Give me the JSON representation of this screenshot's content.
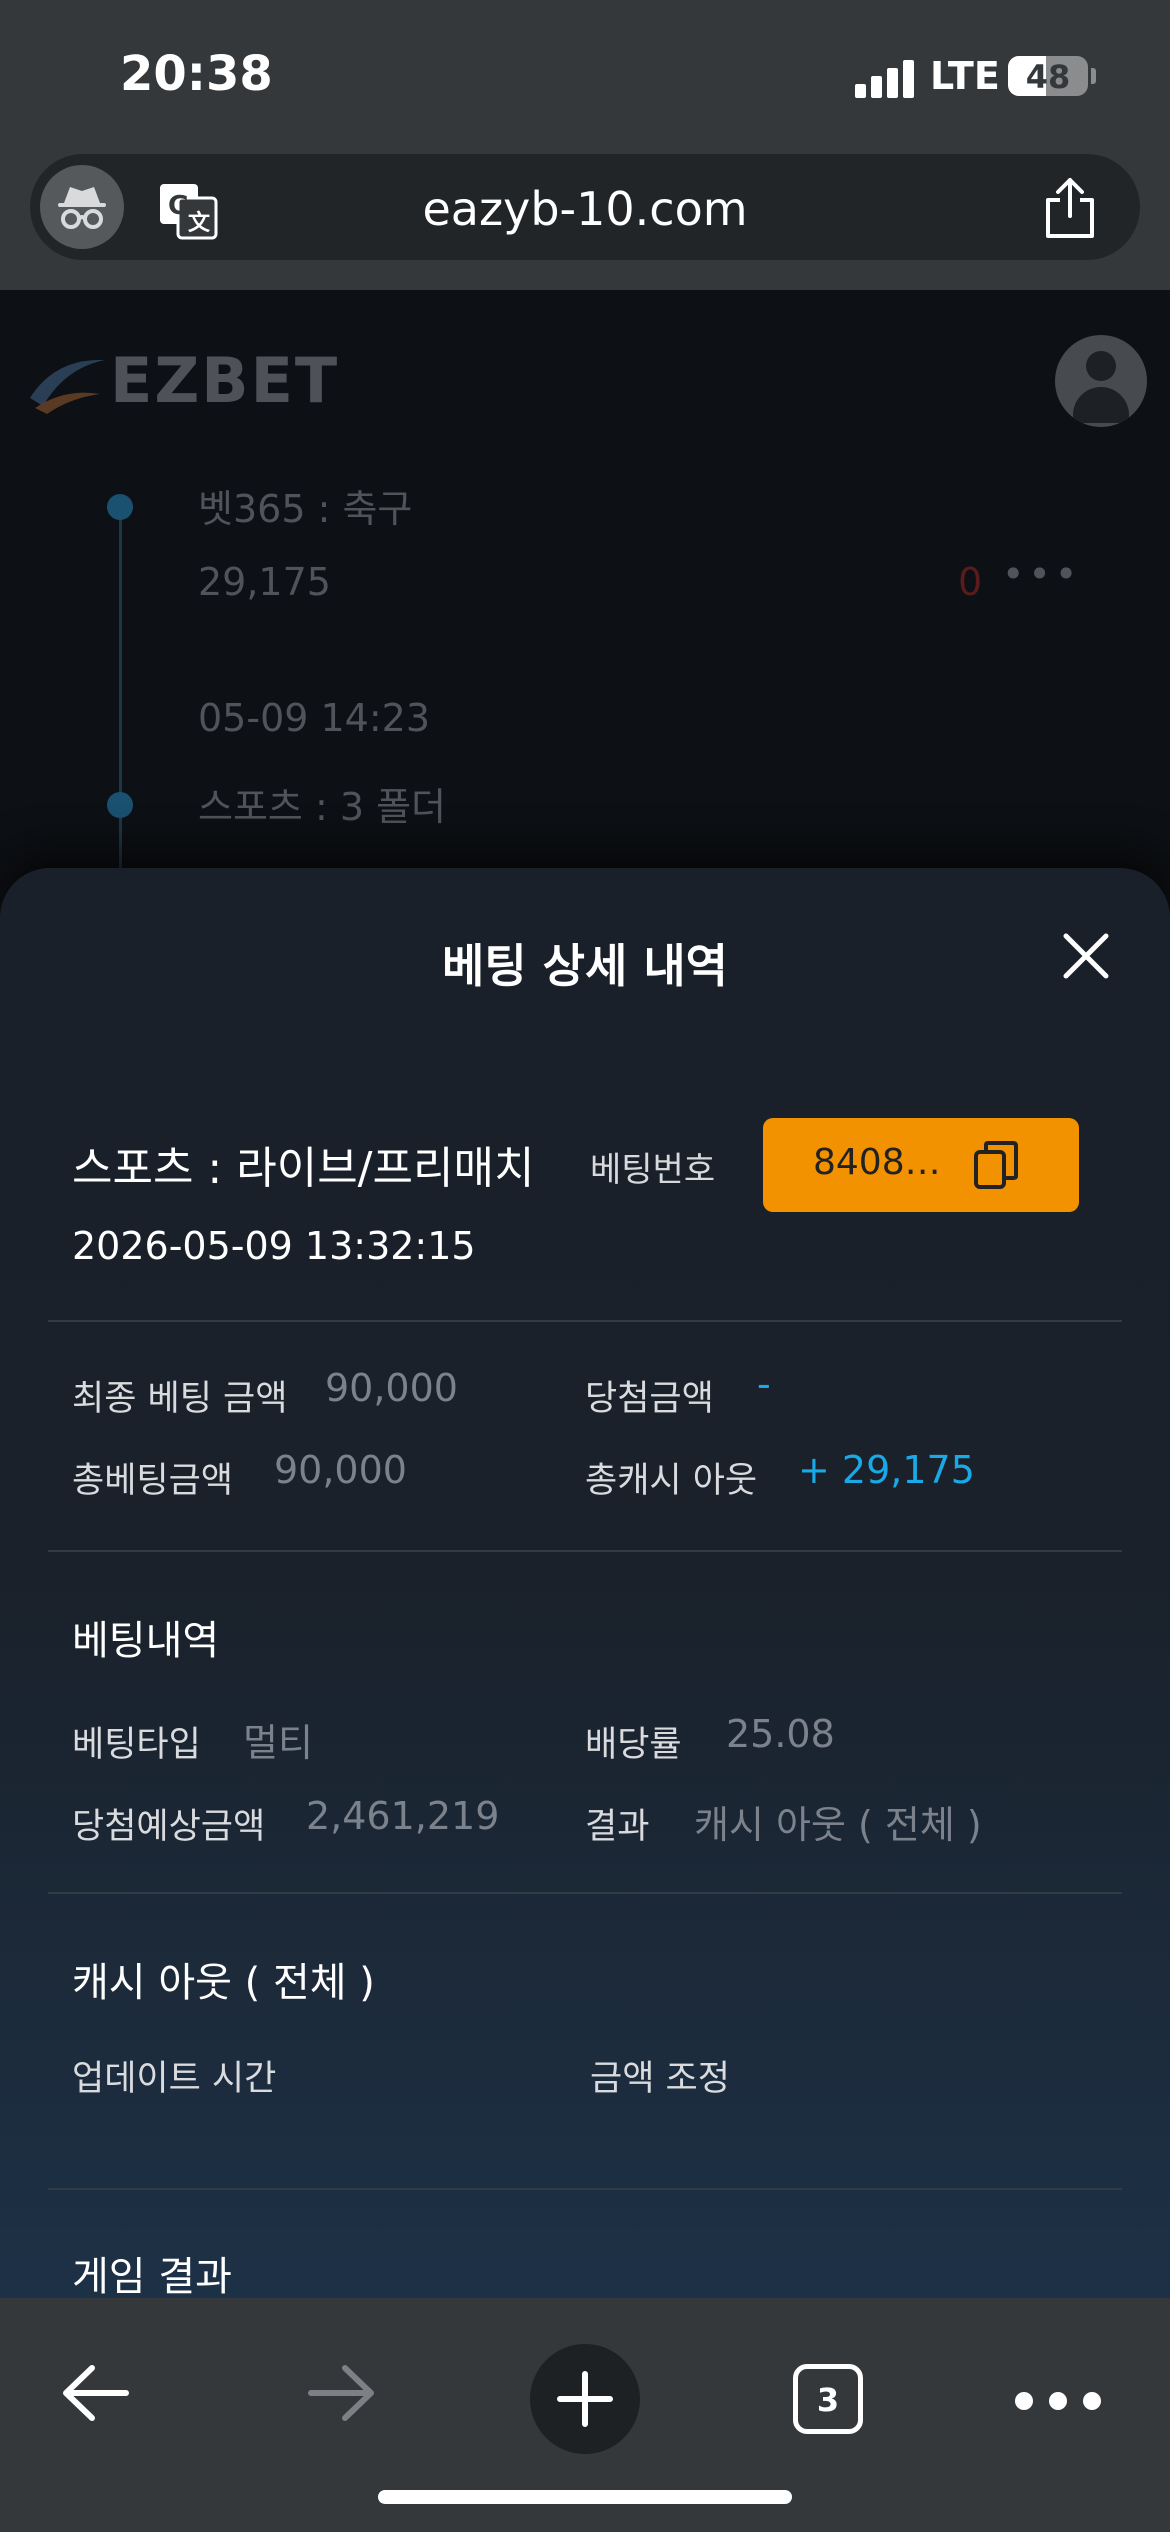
{
  "status_bar": {
    "time": "20:38",
    "network": "LTE",
    "battery": "48",
    "battery_level": 0.48
  },
  "browser": {
    "url": "eazyb-10.com",
    "tab_count": "3"
  },
  "background_page": {
    "brand": "EZBET",
    "items": [
      {
        "title": "벳365 : 축구",
        "amount": "29,175",
        "result": "0"
      },
      {
        "date": "05-09 14:23",
        "title": "스포츠 : 3 폴더"
      }
    ]
  },
  "sheet": {
    "title": "베팅 상세 내역",
    "category": "스포츠 : 라이브/프리매치",
    "bet_number_label": "베팅번호",
    "bet_number": "8408…",
    "datetime": "2026-05-09 13:32:15",
    "summary": {
      "final_bet_label": "최종 베팅 금액",
      "final_bet_value": "90,000",
      "win_label": "당첨금액",
      "win_value": "-",
      "total_bet_label": "총베팅금액",
      "total_bet_value": "90,000",
      "total_cashout_label": "총캐시 아웃",
      "total_cashout_value": "+ 29,175"
    },
    "details": {
      "title": "베팅내역",
      "type_label": "베팅타입",
      "type_value": "멀티",
      "odds_label": "배당률",
      "odds_value": "25.08",
      "expected_label": "당첨예상금액",
      "expected_value": "2,461,219",
      "result_label": "결과",
      "result_value": "캐시 아웃 ( 전체 )"
    },
    "cashout": {
      "title": "캐시 아웃 ( 전체 )",
      "update_time_label": "업데이트 시간",
      "amount_adjust_label": "금액 조정"
    },
    "game_result_title": "게임 결과"
  },
  "colors": {
    "accent": "#f39200",
    "positive": "#1aa8e6",
    "sheet_bg": "#192029",
    "chrome": "#35383b"
  }
}
